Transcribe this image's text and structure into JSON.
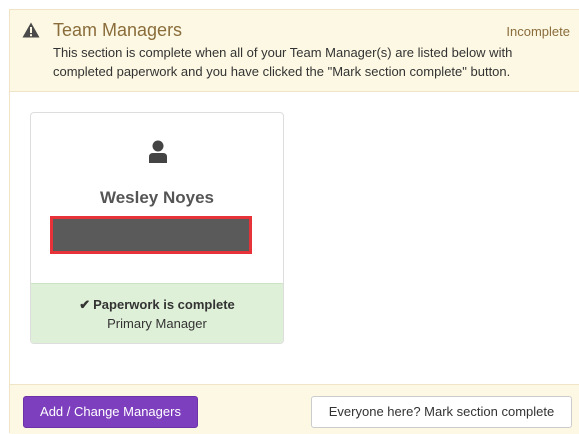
{
  "section": {
    "title": "Team Managers",
    "status": "Incomplete",
    "description": "This section is complete when all of your Team Manager(s) are listed below with completed paperwork and you have clicked the \"Mark section complete\" button.",
    "icon": "warning-icon"
  },
  "managers": [
    {
      "name": "Wesley Noyes",
      "icon": "user-icon",
      "paperwork_status": "Paperwork is complete",
      "role": "Primary Manager"
    }
  ],
  "footer": {
    "add_button_label": "Add / Change Managers",
    "complete_button_label": "Everyone here? Mark section complete"
  },
  "colors": {
    "warning_bg": "#fcf8e3",
    "warning_text": "#8a6d3b",
    "success_bg": "#dff0d8",
    "primary_button": "#7e3fbf",
    "redaction_border": "#e8323a"
  }
}
